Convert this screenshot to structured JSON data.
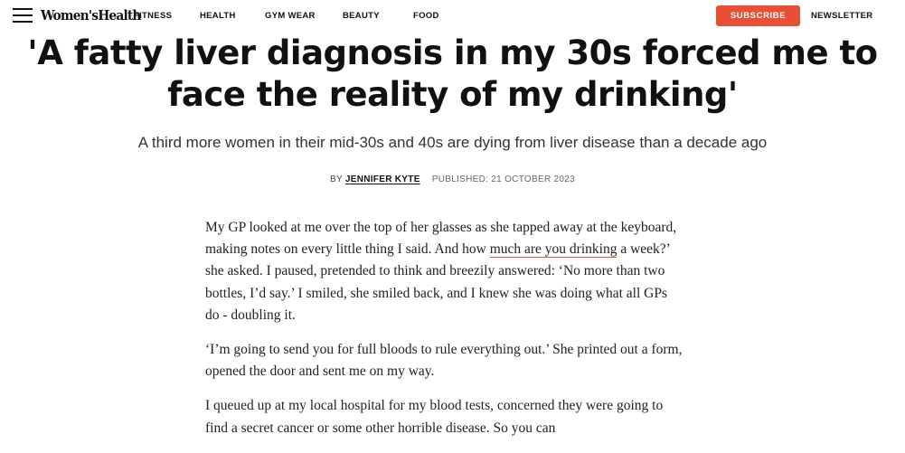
{
  "header": {
    "logo": "Women'sHealth",
    "nav": [
      "FITNESS",
      "HEALTH",
      "GYM WEAR",
      "BEAUTY",
      "FOOD"
    ],
    "subscribe_label": "SUBSCRIBE",
    "newsletter_label": "NEWSLETTER",
    "accent_color": "#e94f34"
  },
  "icons": {
    "menu": "hamburger-menu-icon"
  },
  "article": {
    "headline": "'A fatty liver diagnosis in my 30s forced me to face the reality of my drinking'",
    "subheadline": "A third more women in their mid-30s and 40s are dying from liver disease than a decade ago",
    "byline_prefix": "BY",
    "author": "JENNIFER KYTE",
    "published": "PUBLISHED: 21 OCTOBER 2023",
    "paragraphs": {
      "p1_before_link": "My GP looked at me over the top of her glasses as she tapped away at the keyboard, making notes on every little thing I said. And how ",
      "p1_link": "much are you drinking",
      "p1_after_link": " a week?’ she asked. I paused, pretended to think and breezily answered: ‘No more than two bottles, I’d say.’ I smiled, she smiled back, and I knew she was doing what all GPs do - doubling it.",
      "p2": "‘I’m going to send you for full bloods to rule everything out.’ She printed out a form, opened the door and sent me on my way.",
      "p3": "I queued up at my local hospital for my blood tests, concerned they were going to find a secret cancer or some other horrible disease. So you can"
    }
  }
}
